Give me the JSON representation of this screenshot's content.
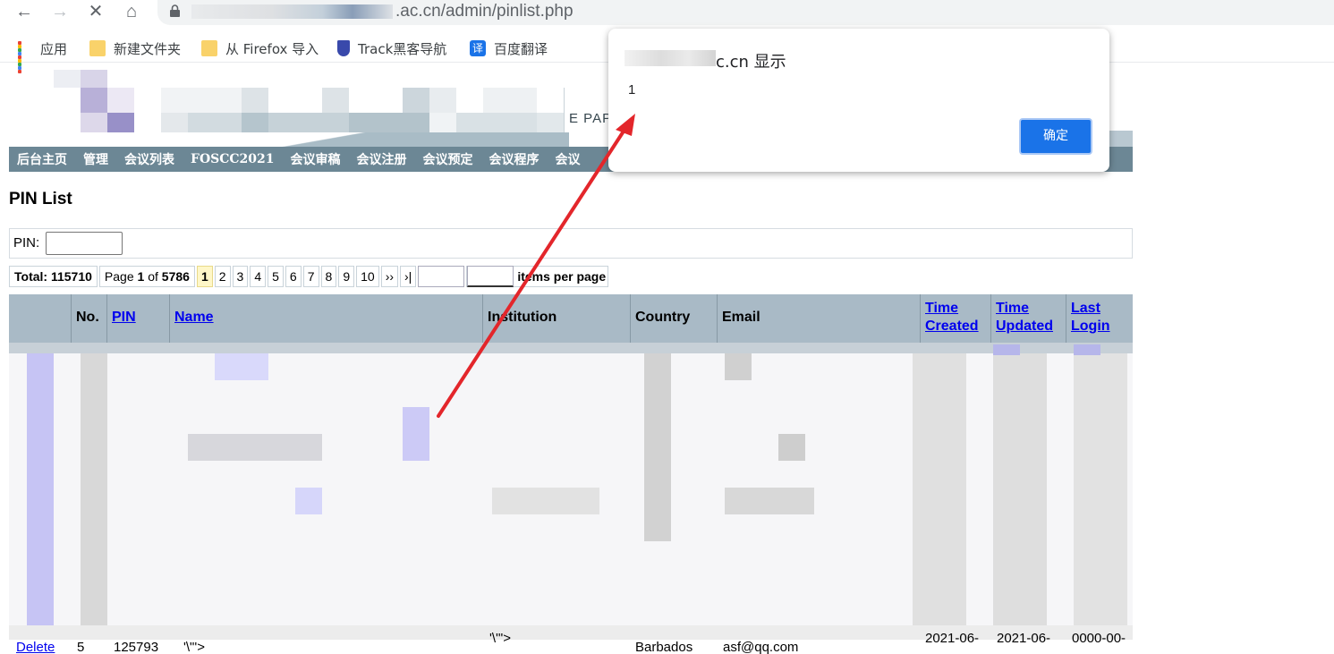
{
  "browser": {
    "url": ".ac.cn/admin/pinlist.php",
    "icons": [
      "back-icon",
      "forward-icon",
      "stop-icon",
      "home-icon",
      "lock-icon"
    ]
  },
  "bookmarks": [
    {
      "label": "应用",
      "icon": "apps-icon"
    },
    {
      "label": "新建文件夹",
      "icon": "folder-icon"
    },
    {
      "label": "从 Firefox 导入",
      "icon": "folder-icon"
    },
    {
      "label": "Track黑客导航",
      "icon": "shield-icon"
    },
    {
      "label": "百度翻译",
      "icon": "translate-icon",
      "glyph": "译"
    }
  ],
  "banner": {
    "text": "E PAPE"
  },
  "admin_nav": [
    "后台主页",
    "管理",
    "会议列表",
    "FOSCC2021",
    "会议审稿",
    "会议注册",
    "会议预定",
    "会议程序",
    "会议"
  ],
  "page": {
    "title": "PIN List",
    "pin_label": "PIN:",
    "pager": {
      "total_label": "Total:",
      "total": "115710",
      "page_label": "Page",
      "current": "1",
      "of_label": "of",
      "pages": "5786",
      "page_links": [
        "1",
        "2",
        "3",
        "4",
        "5",
        "6",
        "7",
        "8",
        "9",
        "10"
      ],
      "next": "››",
      "last": "›|",
      "items_per_page_label": "items per page"
    },
    "table": {
      "columns": [
        "",
        "No.",
        "PIN",
        "Name",
        "Institution",
        "Country",
        "Email",
        "Time Created",
        "Time Updated",
        "Last Login"
      ],
      "column_links": [
        false,
        false,
        true,
        true,
        false,
        false,
        false,
        true,
        true,
        true
      ],
      "partial_row": {
        "action": "Delete",
        "no": "5",
        "pin": "125793",
        "name": "'\\\"'>",
        "institution": "'\\'\">",
        "country": "Barbados",
        "email": "asf@qq.com",
        "time_created": "2021-06-",
        "time_updated": "2021-06-",
        "last_login": "0000-00-"
      }
    }
  },
  "dialog": {
    "title_suffix": "c.cn 显示",
    "message": "1",
    "ok_label": "确定"
  },
  "annotation": {
    "color": "#e3262b"
  }
}
